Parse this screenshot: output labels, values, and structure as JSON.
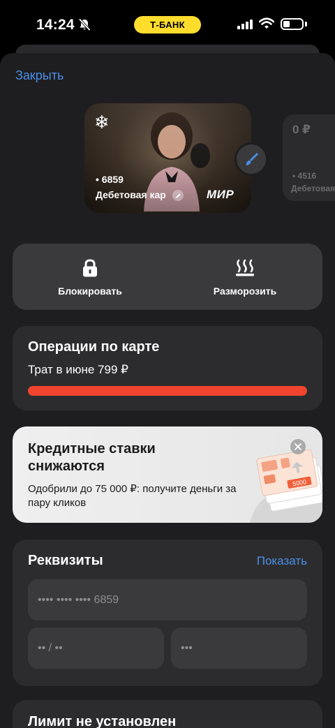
{
  "status_bar": {
    "time": "14:24",
    "bank_pill": "Т-БАНК",
    "battery_level": 0.35,
    "icons": [
      "bell-slash-icon",
      "signal-icon",
      "wifi-icon",
      "battery-icon"
    ]
  },
  "header": {
    "close_label": "Закрыть"
  },
  "card": {
    "number": "• 6859",
    "name": "Дебетовая карта",
    "payment_system": "МИР",
    "frozen_icon": "snowflake-icon"
  },
  "next_card": {
    "balance": "0 ₽",
    "number": "• 4516",
    "name": "Дебетовая"
  },
  "actions": [
    {
      "label": "Блокировать",
      "icon": "lock-icon"
    },
    {
      "label": "Разморозить",
      "icon": "heat-icon"
    }
  ],
  "operations": {
    "title": "Операции по карте",
    "subtitle": "Трат в июне 799 ₽",
    "progress": 1.0,
    "bar_color": "#f1442e"
  },
  "promo": {
    "title": "Кредитные ставки снижаются",
    "text": "Одобрили до 75 000 ₽: получите деньги за пару кликов",
    "banknote_value": "5000"
  },
  "requisites": {
    "title": "Реквизиты",
    "show_label": "Показать",
    "card_number": "•••• •••• •••• 6859",
    "expiry": "•• / ••",
    "cvv": "•••"
  },
  "limit": {
    "title": "Лимит не установлен"
  },
  "colors": {
    "accent_blue": "#4a8fe7",
    "brand_yellow": "#FFDD2D",
    "background": "#1e1e20"
  }
}
